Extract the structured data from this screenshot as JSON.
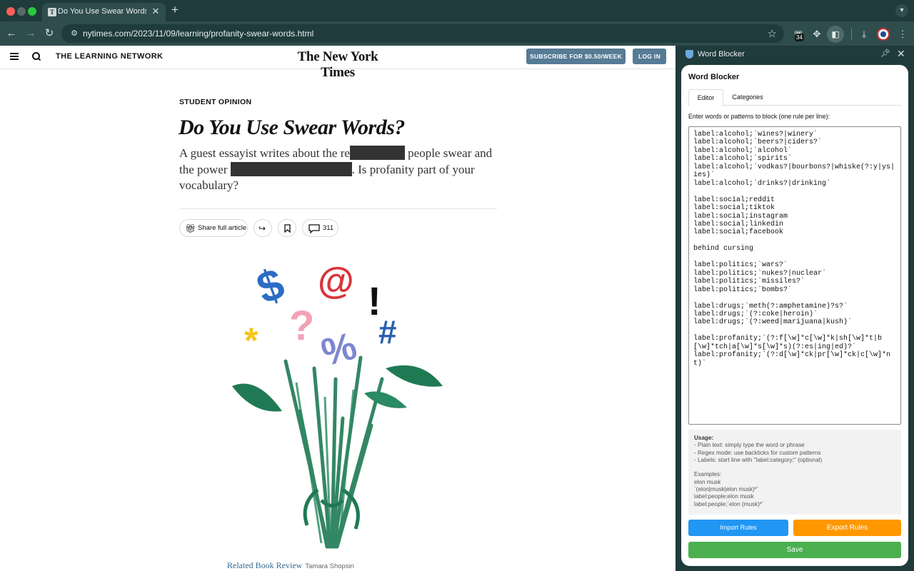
{
  "browser": {
    "tab_title": "Do You Use Swear Words? - T",
    "tab_close": "✕",
    "new_tab": "+",
    "url": "nytimes.com/2023/11/09/learning/profanity-swear-words.html",
    "extension_badge": "34"
  },
  "nyt": {
    "section": "THE LEARNING NETWORK",
    "masthead": "The New York Times",
    "subscribe": "SUBSCRIBE FOR $0.50/WEEK",
    "login": "LOG IN",
    "kicker": "STUDENT OPINION",
    "headline": "Do You Use Swear Words?",
    "dek_part1": "A guest essayist writes about the re",
    "dek_part2": " people swear and the power ",
    "dek_part3": ". Is profanity part of your vocabulary?",
    "share_label": "Share full article",
    "comment_count": "311",
    "caption_link": "Related Book Review",
    "caption_credit": "Tamara Shopsin"
  },
  "panel": {
    "header_title": "Word Blocker",
    "title": "Word Blocker",
    "tabs": [
      "Editor",
      "Categories"
    ],
    "instructions": "Enter words or patterns to block (one rule per line):",
    "rules_text": "label:alcohol;`wines?|winery`\nlabel:alcohol;`beers?|ciders?`\nlabel:alcohol;`alcohol`\nlabel:alcohol;`spirits`\nlabel:alcohol;`vodkas?|bourbons?|whiske(?:y|ys|ies)`\nlabel:alcohol;`drinks?|drinking`\n\nlabel:social;reddit\nlabel:social;tiktok\nlabel:social;instagram\nlabel:social;linkedin\nlabel:social;facebook\n\nbehind cursing\n\nlabel:politics;`wars?`\nlabel:politics;`nukes?|nuclear`\nlabel:politics;`missiles?`\nlabel:politics;`bombs?`\n\nlabel:drugs;`meth(?:amphetamine)?s?`\nlabel:drugs;`(?:coke|heroin)`\nlabel:drugs;`(?:weed|marijuana|kush)`\n\nlabel:profanity;`(?:f[\\w]*c[\\w]*k|sh[\\w]*t|b[\\w]*tch|a[\\w]*s[\\w]*s)(?:es|ing|ed)?`\nlabel:profanity;`(?:d[\\w]*ck|pr[\\w]*ck|c[\\w]*nt)`",
    "usage_title": "Usage:",
    "usage_body": "- Plain text: simply type the word or phrase\n- Regex mode: use backticks for custom patterns\n- Labels: start line with \"label:category;\" (optional)\n\nExamples:\nelon musk\n`(elon|musk|elon musk)*`\nlabel:people;elon musk\nlabel:people;`elon (musk)*`",
    "import_label": "Import Rules",
    "export_label": "Export Rules",
    "save_label": "Save"
  },
  "colors": {
    "chrome": "#1f3b3b",
    "import": "#2196f3",
    "export": "#ff9800",
    "save": "#4caf50",
    "subscribe": "#567b95"
  },
  "icons": [
    "back-icon",
    "forward-icon",
    "reload-icon",
    "site-info-icon",
    "bookmark-star-icon",
    "extension-icon",
    "puzzle-icon",
    "side-panel-icon",
    "download-icon",
    "profile-icon",
    "menu-icon",
    "hamburger-icon",
    "search-icon",
    "gift-icon",
    "share-icon",
    "bookmark-icon",
    "comment-icon",
    "pin-icon",
    "close-icon",
    "shield-icon"
  ]
}
